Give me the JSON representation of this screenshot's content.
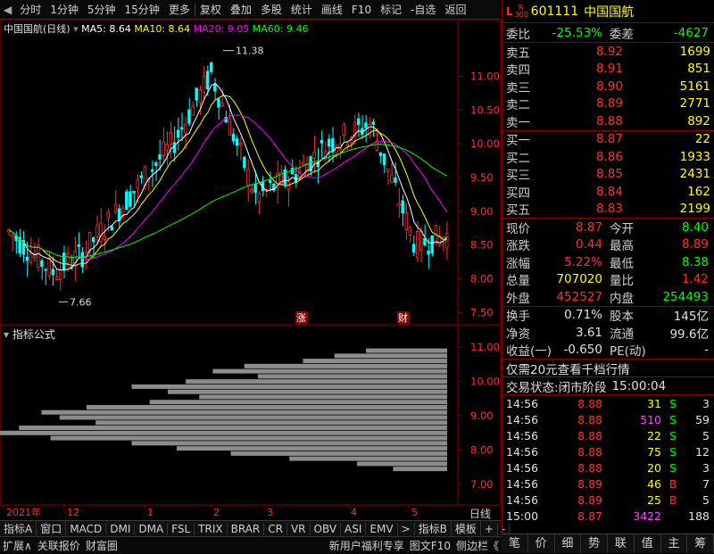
{
  "toolbar": {
    "items": [
      "分时",
      "1分钟",
      "5分钟",
      "15分钟",
      "更多",
      "复权",
      "叠加",
      "多股",
      "统计",
      "画线",
      "F10",
      "标记",
      "-自选",
      "返回"
    ]
  },
  "chart": {
    "stock_label": "中国国航(日线)",
    "ma5": "MA5: 8.64",
    "ma10": "MA10: 8.64",
    "ma20": "MA20: 9.05",
    "ma60": "MA60: 9.46",
    "high_label": "11.38",
    "low_label": "7.66",
    "price_ticks": [
      "11.00",
      "10.50",
      "10.00",
      "9.50",
      "9.00",
      "8.50",
      "8.00",
      "7.50"
    ],
    "indicator_title": "指标公式",
    "indicator_ticks": [
      "11.00",
      "10.00",
      "9.00",
      "8.00",
      "7.00"
    ],
    "event_markers": [
      "涨",
      "财"
    ],
    "time_axis": [
      "2021年",
      "12",
      "1",
      "2",
      "3",
      "4",
      "5"
    ],
    "period_label": "日线"
  },
  "chart_data": {
    "type": "candlestick",
    "title": "中国国航(日线)",
    "moving_averages": {
      "MA5": 8.64,
      "MA10": 8.64,
      "MA20": 9.05,
      "MA60": 9.46
    },
    "ylim": [
      7.4,
      11.6
    ],
    "high": 11.38,
    "low": 7.66,
    "volume_profile_prices": [
      10.9,
      10.75,
      10.6,
      10.45,
      10.3,
      10.15,
      10.0,
      9.85,
      9.7,
      9.55,
      9.4,
      9.25,
      9.1,
      8.95,
      8.8,
      8.65,
      8.5,
      8.35,
      8.2,
      8.05,
      7.9,
      7.75,
      7.6,
      7.45
    ],
    "volume_profile_values": [
      0.18,
      0.25,
      0.32,
      0.45,
      0.52,
      0.42,
      0.58,
      0.7,
      0.62,
      0.55,
      0.66,
      0.8,
      0.9,
      0.86,
      0.78,
      0.95,
      1.0,
      0.88,
      0.7,
      0.6,
      0.48,
      0.35,
      0.2,
      0.12
    ]
  },
  "tabs": [
    "指标A",
    "窗口",
    "MACD",
    "DMI",
    "DMA",
    "FSL",
    "TRIX",
    "BRAR",
    "CR",
    "VR",
    "OBV",
    "ASI",
    "EMV",
    ">",
    "指标B",
    "模板",
    "+",
    "-"
  ],
  "bottom": {
    "left": [
      "扩展∧",
      "关联报价",
      "财富圈"
    ],
    "right": [
      "新用户福利专享",
      "图文F10",
      "侧边栏《"
    ]
  },
  "quote": {
    "market": "L",
    "market_sub": "R 300",
    "code": "601111",
    "name": "中国国航",
    "weibi_label": "委比",
    "weibi": "-25.53%",
    "weicha_label": "委差",
    "weicha": "-4627",
    "asks": [
      {
        "label": "卖五",
        "price": "8.92",
        "vol": "1699"
      },
      {
        "label": "卖四",
        "price": "8.91",
        "vol": "851"
      },
      {
        "label": "卖三",
        "price": "8.90",
        "vol": "5161"
      },
      {
        "label": "卖二",
        "price": "8.89",
        "vol": "2771"
      },
      {
        "label": "卖一",
        "price": "8.88",
        "vol": "892"
      }
    ],
    "bids": [
      {
        "label": "买一",
        "price": "8.87",
        "vol": "22"
      },
      {
        "label": "买二",
        "price": "8.86",
        "vol": "1933"
      },
      {
        "label": "买三",
        "price": "8.85",
        "vol": "2431"
      },
      {
        "label": "买四",
        "price": "8.84",
        "vol": "162"
      },
      {
        "label": "买五",
        "price": "8.83",
        "vol": "2199"
      }
    ],
    "stats": [
      {
        "l1": "现价",
        "v1": "8.87",
        "c1": "red",
        "l2": "今开",
        "v2": "8.40",
        "c2": "green"
      },
      {
        "l1": "涨跌",
        "v1": "0.44",
        "c1": "red",
        "l2": "最高",
        "v2": "8.89",
        "c2": "red"
      },
      {
        "l1": "涨幅",
        "v1": "5.22%",
        "c1": "red",
        "l2": "最低",
        "v2": "8.38",
        "c2": "green"
      },
      {
        "l1": "总量",
        "v1": "707020",
        "c1": "yellow",
        "l2": "量比",
        "v2": "1.42",
        "c2": "red"
      },
      {
        "l1": "外盘",
        "v1": "452527",
        "c1": "red",
        "l2": "内盘",
        "v2": "254493",
        "c2": "green"
      }
    ],
    "stats2": [
      {
        "l1": "换手",
        "v1": "0.71%",
        "l2": "股本",
        "v2": "145亿"
      },
      {
        "l1": "净资",
        "v1": "3.61",
        "l2": "流通",
        "v2": "99.6亿"
      },
      {
        "l1": "收益(一)",
        "v1": "-0.650",
        "l2": "PE(动)",
        "v2": "-"
      }
    ],
    "promo": "仅需20元查看千档行情",
    "status_label": "交易状态:",
    "status": "闭市阶段",
    "status_time": "15:00:04",
    "ticks": [
      {
        "t": "14:56",
        "p": "8.88",
        "v": "31",
        "vc": "yellow",
        "s": "S",
        "sc": "green",
        "n": "3"
      },
      {
        "t": "14:56",
        "p": "8.88",
        "v": "510",
        "vc": "purple",
        "s": "S",
        "sc": "green",
        "n": "59"
      },
      {
        "t": "14:56",
        "p": "8.88",
        "v": "22",
        "vc": "yellow",
        "s": "S",
        "sc": "green",
        "n": "5"
      },
      {
        "t": "14:56",
        "p": "8.88",
        "v": "75",
        "vc": "yellow",
        "s": "S",
        "sc": "green",
        "n": "12"
      },
      {
        "t": "14:56",
        "p": "8.88",
        "v": "20",
        "vc": "yellow",
        "s": "S",
        "sc": "green",
        "n": "3"
      },
      {
        "t": "14:56",
        "p": "8.89",
        "v": "46",
        "vc": "yellow",
        "s": "B",
        "sc": "red",
        "n": "7"
      },
      {
        "t": "14:56",
        "p": "8.89",
        "v": "25",
        "vc": "yellow",
        "s": "B",
        "sc": "red",
        "n": "5"
      },
      {
        "t": "15:00",
        "p": "8.87",
        "v": "3422",
        "vc": "purple",
        "s": "",
        "sc": "white",
        "n": "188"
      }
    ],
    "bottom_tabs": [
      "笔",
      "价",
      "细",
      "势",
      "联",
      "值",
      "主",
      "筹"
    ]
  }
}
